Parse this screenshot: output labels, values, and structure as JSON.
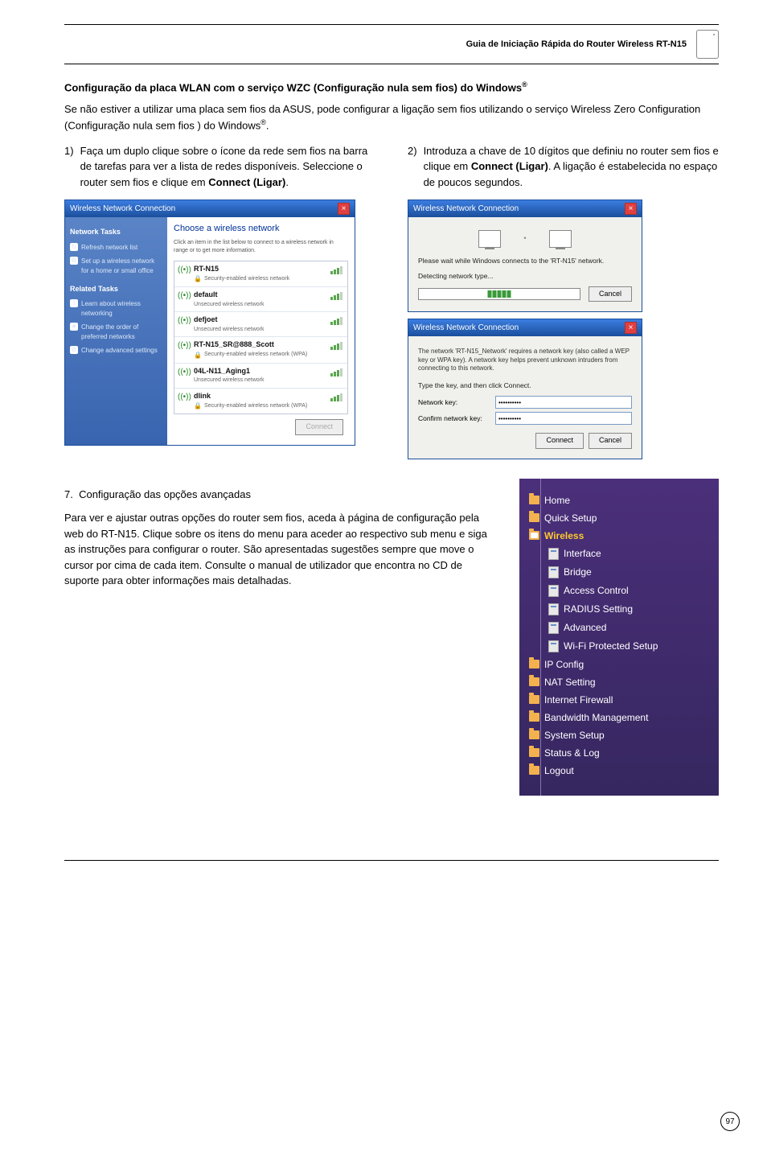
{
  "header": {
    "title": "Guia de Iniciação Rápida do Router Wireless RT-N15"
  },
  "section_wlan": {
    "title": "Configuração da placa WLAN com o serviço WZC (Configuração nula sem fios) do Windows",
    "reg": "®",
    "intro": "Se não estiver a utilizar uma placa sem fios da ASUS, pode configurar a ligação sem fios utilizando o serviço Wireless Zero Configuration (Configuração nula sem fios ) do Windows",
    "step1_num": "1)",
    "step1": "Faça um duplo clique sobre o ícone da rede sem fios na barra de tarefas para ver a lista de redes disponíveis. Seleccione o router sem fios e clique em ",
    "step1_bold": "Connect (Ligar)",
    "step2_num": "2)",
    "step2_a": "Introduza a chave de 10 dígitos que definiu no router sem fios e clique em ",
    "step2_bold": "Connect (Ligar)",
    "step2_b": ". A ligação é estabelecida no espaço de poucos segundos."
  },
  "wireless_window": {
    "title": "Wireless Network Connection",
    "side_head1": "Network Tasks",
    "side_item1": "Refresh network list",
    "side_item2": "Set up a wireless network for a home or small office",
    "side_head2": "Related Tasks",
    "side_item3": "Learn about wireless networking",
    "side_item4": "Change the order of preferred networks",
    "side_item5": "Change advanced settings",
    "choose_title": "Choose a wireless network",
    "choose_desc": "Click an item in the list below to connect to a wireless network in range or to get more information.",
    "net1_name": "RT-N15",
    "net1_sub": "Security-enabled wireless network",
    "net2_name": "default",
    "net2_sub": "Unsecured wireless network",
    "net3_name": "defjoet",
    "net3_sub": "Unsecured wireless network",
    "net4_name": "RT-N15_SR@888_Scott",
    "net4_sub": "Security-enabled wireless network (WPA)",
    "net5_name": "04L-N11_Aging1",
    "net5_sub": "Unsecured wireless network",
    "net6_name": "dlink",
    "net6_sub": "Security-enabled wireless network (WPA)",
    "connect_btn": "Connect"
  },
  "connect_dialog": {
    "title": "Wireless Network Connection",
    "wait_text": "Please wait while Windows connects to the 'RT-N15' network.",
    "detect_text": "Detecting network type...",
    "cancel_btn": "Cancel"
  },
  "key_dialog": {
    "title": "Wireless Network Connection",
    "desc": "The network 'RT-N15_Network' requires a network key (also called a WEP key or WPA key). A network key helps prevent unknown intruders from connecting to this network.",
    "type_prompt": "Type the key, and then click Connect.",
    "label1": "Network key:",
    "label2": "Confirm network key:",
    "connect_btn": "Connect",
    "cancel_btn": "Cancel",
    "dots": "••••••••••"
  },
  "section7": {
    "num": "7.",
    "title": "Configuração das opções avançadas",
    "body": "Para ver e ajustar outras opções do router sem fios, aceda à página de configuração pela web do RT-N15. Clique sobre os itens do menu para aceder ao respectivo sub menu e siga as instruções para configurar o router. São apresentadas sugestões sempre que move o cursor por cima de cada item. Consulte o manual de utilizador que encontra no CD de suporte para obter informações mais detalhadas."
  },
  "tree": {
    "home": "Home",
    "quick": "Quick Setup",
    "wireless": "Wireless",
    "interface": "Interface",
    "bridge": "Bridge",
    "access": "Access Control",
    "radius": "RADIUS Setting",
    "advanced": "Advanced",
    "wps": "Wi-Fi Protected Setup",
    "ip": "IP Config",
    "nat": "NAT Setting",
    "firewall": "Internet Firewall",
    "bandwidth": "Bandwidth Management",
    "system": "System Setup",
    "status": "Status & Log",
    "logout": "Logout"
  },
  "page_number": "97"
}
